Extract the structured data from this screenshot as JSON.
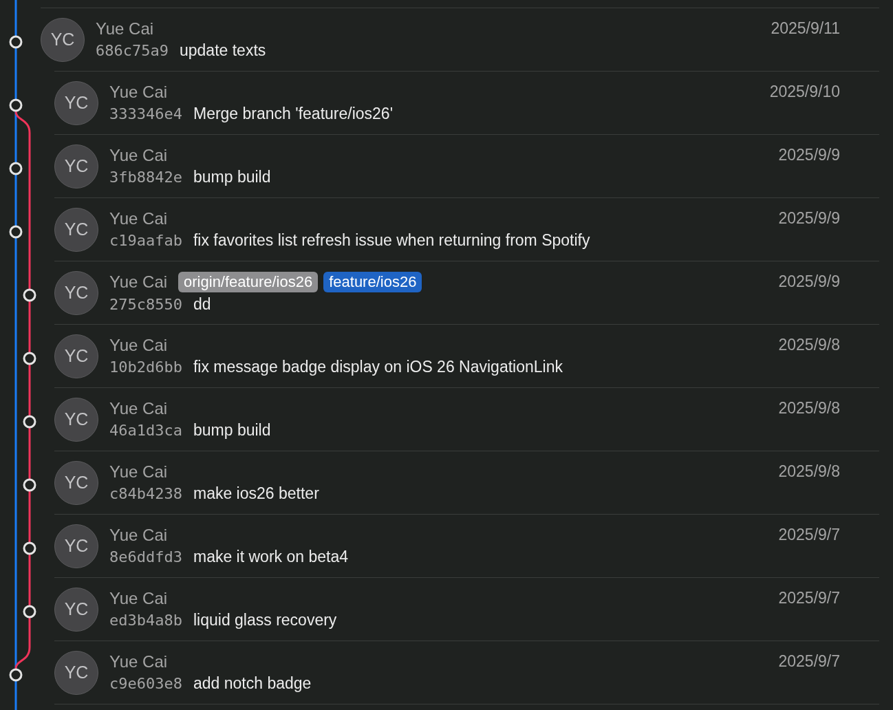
{
  "commits": [
    {
      "initials": "YC",
      "author": "Yue Cai",
      "hash": "686c75a9",
      "message": "update texts",
      "date": "2025/9/11",
      "kind": "main"
    },
    {
      "initials": "YC",
      "author": "Yue Cai",
      "hash": "333346e4",
      "message": "Merge branch 'feature/ios26'",
      "date": "2025/9/10",
      "kind": "merge"
    },
    {
      "initials": "YC",
      "author": "Yue Cai",
      "hash": "3fb8842e",
      "message": "bump build",
      "date": "2025/9/9",
      "kind": "main"
    },
    {
      "initials": "YC",
      "author": "Yue Cai",
      "hash": "c19aafab",
      "message": "fix favorites list refresh issue when returning from Spotify",
      "date": "2025/9/9",
      "kind": "main"
    },
    {
      "initials": "YC",
      "author": "Yue Cai",
      "hash": "275c8550",
      "message": "dd",
      "date": "2025/9/9",
      "kind": "branch",
      "refs": [
        {
          "label": "origin/feature/ios26",
          "kind": "remote"
        },
        {
          "label": "feature/ios26",
          "kind": "local"
        }
      ]
    },
    {
      "initials": "YC",
      "author": "Yue Cai",
      "hash": "10b2d6bb",
      "message": "fix message badge display on iOS 26 NavigationLink",
      "date": "2025/9/8",
      "kind": "branch"
    },
    {
      "initials": "YC",
      "author": "Yue Cai",
      "hash": "46a1d3ca",
      "message": "bump build",
      "date": "2025/9/8",
      "kind": "branch"
    },
    {
      "initials": "YC",
      "author": "Yue Cai",
      "hash": "c84b4238",
      "message": "make ios26 better",
      "date": "2025/9/8",
      "kind": "branch"
    },
    {
      "initials": "YC",
      "author": "Yue Cai",
      "hash": "8e6ddfd3",
      "message": "make it work on beta4",
      "date": "2025/9/7",
      "kind": "branch"
    },
    {
      "initials": "YC",
      "author": "Yue Cai",
      "hash": "ed3b4a8b",
      "message": "liquid glass recovery",
      "date": "2025/9/7",
      "kind": "branch"
    },
    {
      "initials": "YC",
      "author": "Yue Cai",
      "hash": "c9e603e8",
      "message": "add notch badge",
      "date": "2025/9/7",
      "kind": "main"
    }
  ]
}
